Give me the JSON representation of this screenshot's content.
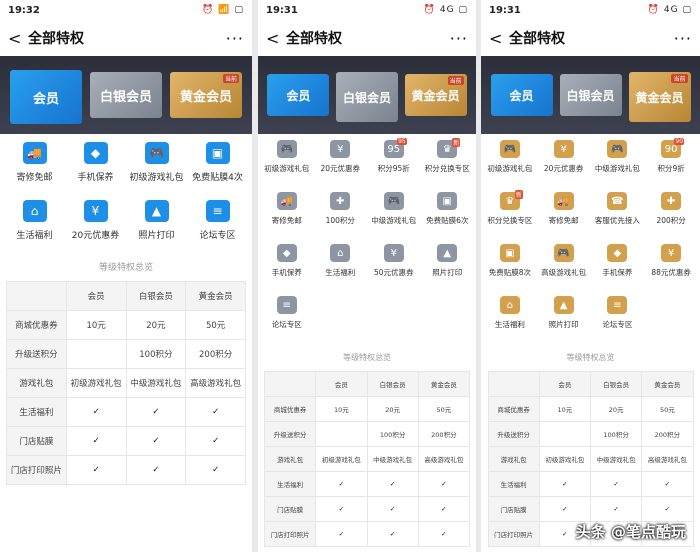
{
  "phones": [
    {
      "status": {
        "time": "19:32",
        "right": "⏰ 📶 ▢"
      },
      "nav": {
        "back": "<",
        "title": "全部特权",
        "more": "···"
      },
      "tiers": [
        "会员",
        "白银会员",
        "黄金会员"
      ],
      "tier_tag": "当前",
      "privileges": [
        {
          "label": "寄修免邮",
          "color": "blue",
          "glyph": "🚚"
        },
        {
          "label": "手机保养",
          "color": "blue",
          "glyph": "◆"
        },
        {
          "label": "初级游戏礼包",
          "color": "blue",
          "glyph": "🎮"
        },
        {
          "label": "免费贴膜4次",
          "color": "blue",
          "glyph": "▣"
        },
        {
          "label": "生活福利",
          "color": "blue",
          "glyph": "⌂"
        },
        {
          "label": "20元优惠券",
          "color": "blue",
          "glyph": "¥"
        },
        {
          "label": "照片打印",
          "color": "blue",
          "glyph": "▲"
        },
        {
          "label": "论坛专区",
          "color": "blue",
          "glyph": "≡"
        }
      ],
      "section": "等级特权总览",
      "table": {
        "header": [
          "",
          "会员",
          "白银会员",
          "黄金会员"
        ],
        "rows": [
          [
            "商城优惠券",
            "10元",
            "20元",
            "50元"
          ],
          [
            "升级送积分",
            "",
            "100积分",
            "200积分"
          ],
          [
            "游戏礼包",
            "初级游戏礼包",
            "中级游戏礼包",
            "高级游戏礼包"
          ],
          [
            "生活福利",
            "✓",
            "✓",
            "✓"
          ],
          [
            "门店贴膜",
            "✓",
            "✓",
            "✓"
          ],
          [
            "门店打印照片",
            "✓",
            "✓",
            "✓"
          ]
        ]
      }
    },
    {
      "status": {
        "time": "19:31",
        "right": "⏰ 4G ▢"
      },
      "nav": {
        "back": "<",
        "title": "全部特权",
        "more": "···"
      },
      "tiers": [
        "会员",
        "白银会员",
        "黄金会员"
      ],
      "tier_tag": "当前",
      "privileges": [
        {
          "label": "初级游戏礼包",
          "color": "gray",
          "glyph": "🎮"
        },
        {
          "label": "20元优惠券",
          "color": "gray",
          "glyph": "¥"
        },
        {
          "label": "积分95折",
          "color": "gray",
          "glyph": "95",
          "badge": "95"
        },
        {
          "label": "积分兑换专区",
          "color": "gray",
          "glyph": "♛",
          "badge": "新"
        },
        {
          "label": "寄修免邮",
          "color": "gray",
          "glyph": "🚚"
        },
        {
          "label": "100积分",
          "color": "gray",
          "glyph": "✚"
        },
        {
          "label": "中级游戏礼包",
          "color": "gray",
          "glyph": "🎮"
        },
        {
          "label": "免费贴膜6次",
          "color": "gray",
          "glyph": "▣"
        },
        {
          "label": "手机保养",
          "color": "gray",
          "glyph": "◆"
        },
        {
          "label": "生活福利",
          "color": "gray",
          "glyph": "⌂"
        },
        {
          "label": "50元优惠券",
          "color": "gray",
          "glyph": "¥"
        },
        {
          "label": "照片打印",
          "color": "gray",
          "glyph": "▲"
        },
        {
          "label": "论坛专区",
          "color": "gray",
          "glyph": "≡"
        }
      ],
      "section": "等级特权总览",
      "table": {
        "header": [
          "",
          "会员",
          "白银会员",
          "黄金会员"
        ],
        "rows": [
          [
            "商城优惠券",
            "10元",
            "20元",
            "50元"
          ],
          [
            "升级送积分",
            "",
            "100积分",
            "200积分"
          ],
          [
            "游戏礼包",
            "初级游戏礼包",
            "中级游戏礼包",
            "高级游戏礼包"
          ],
          [
            "生活福利",
            "✓",
            "✓",
            "✓"
          ],
          [
            "门店贴膜",
            "✓",
            "✓",
            "✓"
          ],
          [
            "门店打印照片",
            "✓",
            "✓",
            "✓"
          ]
        ]
      }
    },
    {
      "status": {
        "time": "19:31",
        "right": "⏰ 4G ▢"
      },
      "nav": {
        "back": "<",
        "title": "全部特权",
        "more": "···"
      },
      "tiers": [
        "会员",
        "白银会员",
        "黄金会员"
      ],
      "tier_tag": "当前",
      "privileges": [
        {
          "label": "初级游戏礼包",
          "color": "gold",
          "glyph": "🎮"
        },
        {
          "label": "20元优惠券",
          "color": "gold",
          "glyph": "¥"
        },
        {
          "label": "中级游戏礼包",
          "color": "gold",
          "glyph": "🎮"
        },
        {
          "label": "积分9折",
          "color": "gold",
          "glyph": "90",
          "badge": "90"
        },
        {
          "label": "积分兑换专区",
          "color": "gold",
          "glyph": "♛",
          "badge": "新"
        },
        {
          "label": "寄修免邮",
          "color": "gold",
          "glyph": "🚚"
        },
        {
          "label": "客服优先接入",
          "color": "gold",
          "glyph": "☎"
        },
        {
          "label": "200积分",
          "color": "gold",
          "glyph": "✚"
        },
        {
          "label": "免费贴膜8次",
          "color": "gold",
          "glyph": "▣"
        },
        {
          "label": "高级游戏礼包",
          "color": "gold",
          "glyph": "🎮"
        },
        {
          "label": "手机保养",
          "color": "gold",
          "glyph": "◆"
        },
        {
          "label": "88元优惠券",
          "color": "gold",
          "glyph": "¥"
        },
        {
          "label": "生活福利",
          "color": "gold",
          "glyph": "⌂"
        },
        {
          "label": "照片打印",
          "color": "gold",
          "glyph": "▲"
        },
        {
          "label": "论坛专区",
          "color": "gold",
          "glyph": "≡"
        }
      ],
      "section": "等级特权总览",
      "table": {
        "header": [
          "",
          "会员",
          "白银会员",
          "黄金会员"
        ],
        "rows": [
          [
            "商城优惠券",
            "10元",
            "20元",
            "50元"
          ],
          [
            "升级送积分",
            "",
            "100积分",
            "200积分"
          ],
          [
            "游戏礼包",
            "初级游戏礼包",
            "中级游戏礼包",
            "高级游戏礼包"
          ],
          [
            "生活福利",
            "✓",
            "✓",
            "✓"
          ],
          [
            "门店贴膜",
            "✓",
            "✓",
            "✓"
          ],
          [
            "门店打印照片",
            "✓",
            "✓",
            "✓"
          ]
        ]
      }
    }
  ],
  "selected_tiers": [
    0,
    1,
    2
  ],
  "colors": {
    "blue": "#1e8fe6",
    "gray": "#8f96a3",
    "gold": "#d3a04e"
  },
  "watermark": "头条 @笔点酷玩"
}
